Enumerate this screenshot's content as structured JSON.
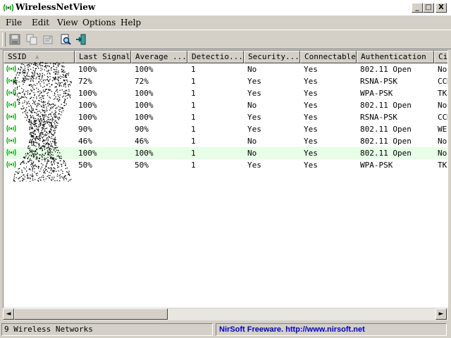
{
  "window": {
    "title": "WirelessNetView",
    "min_symbol": "_",
    "max_symbol": "□",
    "close_symbol": "X"
  },
  "menu": [
    {
      "label": "File",
      "key": "F"
    },
    {
      "label": "Edit",
      "key": "E"
    },
    {
      "label": "View",
      "key": "V"
    },
    {
      "label": "Options",
      "key": "O"
    },
    {
      "label": "Help",
      "key": "H"
    }
  ],
  "toolbar": {
    "buttons": [
      "save-icon",
      "copy-icon",
      "properties-icon",
      "find-icon",
      "exit-icon"
    ]
  },
  "columns": [
    "SSID",
    "Last Signal",
    "Average ...",
    "Detectio...",
    "Security...",
    "Connectable",
    "Authentication",
    "Ci"
  ],
  "sort_arrow": "▲",
  "rows": [
    {
      "ssid": "",
      "last_signal": "100%",
      "average": "100%",
      "detection": "1",
      "security": "No",
      "connectable": "Yes",
      "auth": "802.11 Open",
      "cipher": "Non"
    },
    {
      "ssid": "",
      "last_signal": "72%",
      "average": "72%",
      "detection": "1",
      "security": "Yes",
      "connectable": "Yes",
      "auth": "RSNA-PSK",
      "cipher": "CCM"
    },
    {
      "ssid": "",
      "last_signal": "100%",
      "average": "100%",
      "detection": "1",
      "security": "Yes",
      "connectable": "Yes",
      "auth": "WPA-PSK",
      "cipher": "TKI"
    },
    {
      "ssid": "",
      "last_signal": "100%",
      "average": "100%",
      "detection": "1",
      "security": "No",
      "connectable": "Yes",
      "auth": "802.11 Open",
      "cipher": "Non"
    },
    {
      "ssid": "",
      "last_signal": "100%",
      "average": "100%",
      "detection": "1",
      "security": "Yes",
      "connectable": "Yes",
      "auth": "RSNA-PSK",
      "cipher": "CCM"
    },
    {
      "ssid": "",
      "last_signal": "90%",
      "average": "90%",
      "detection": "1",
      "security": "Yes",
      "connectable": "Yes",
      "auth": "802.11 Open",
      "cipher": "WEP"
    },
    {
      "ssid": "",
      "last_signal": "46%",
      "average": "46%",
      "detection": "1",
      "security": "No",
      "connectable": "Yes",
      "auth": "802.11 Open",
      "cipher": "Non"
    },
    {
      "ssid": "",
      "last_signal": "100%",
      "average": "100%",
      "detection": "1",
      "security": "No",
      "connectable": "Yes",
      "auth": "802.11 Open",
      "cipher": "Non"
    },
    {
      "ssid": "",
      "last_signal": "50%",
      "average": "50%",
      "detection": "1",
      "security": "Yes",
      "connectable": "Yes",
      "auth": "WPA-PSK",
      "cipher": "TKI"
    }
  ],
  "selected_row": 7,
  "scroll": {
    "left_arrow": "◄",
    "right_arrow": "►"
  },
  "status": {
    "count": "9 Wireless Networks",
    "credit": "NirSoft Freeware.  http://www.nirsoft.net"
  },
  "colors": {
    "selected_row_bg": "#e6ffe6",
    "credit_text": "#0000c0",
    "signal_icon": "#00a000"
  }
}
